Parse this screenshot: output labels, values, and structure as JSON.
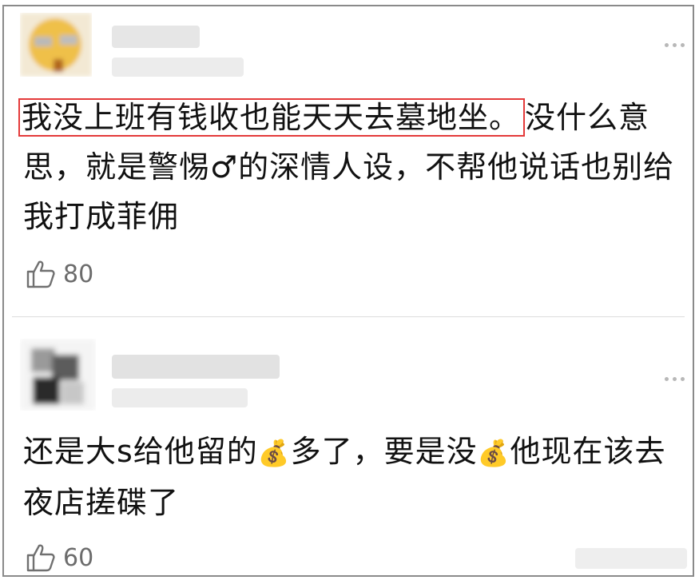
{
  "comments": [
    {
      "text_highlighted": "我没上班有钱收也能天天去墓地坐。",
      "text_rest": "没什么意思，就是警惕♂的深情人设，不帮他说话也别给我打成菲佣",
      "likes": "80",
      "highlight_color": "#e43a3a"
    },
    {
      "text_part1": "还是大s给他留的",
      "money_icon": "💰",
      "text_part2": "多了，要是没",
      "text_part3": "他现在该去夜店搓碟了",
      "likes": "60"
    }
  ]
}
